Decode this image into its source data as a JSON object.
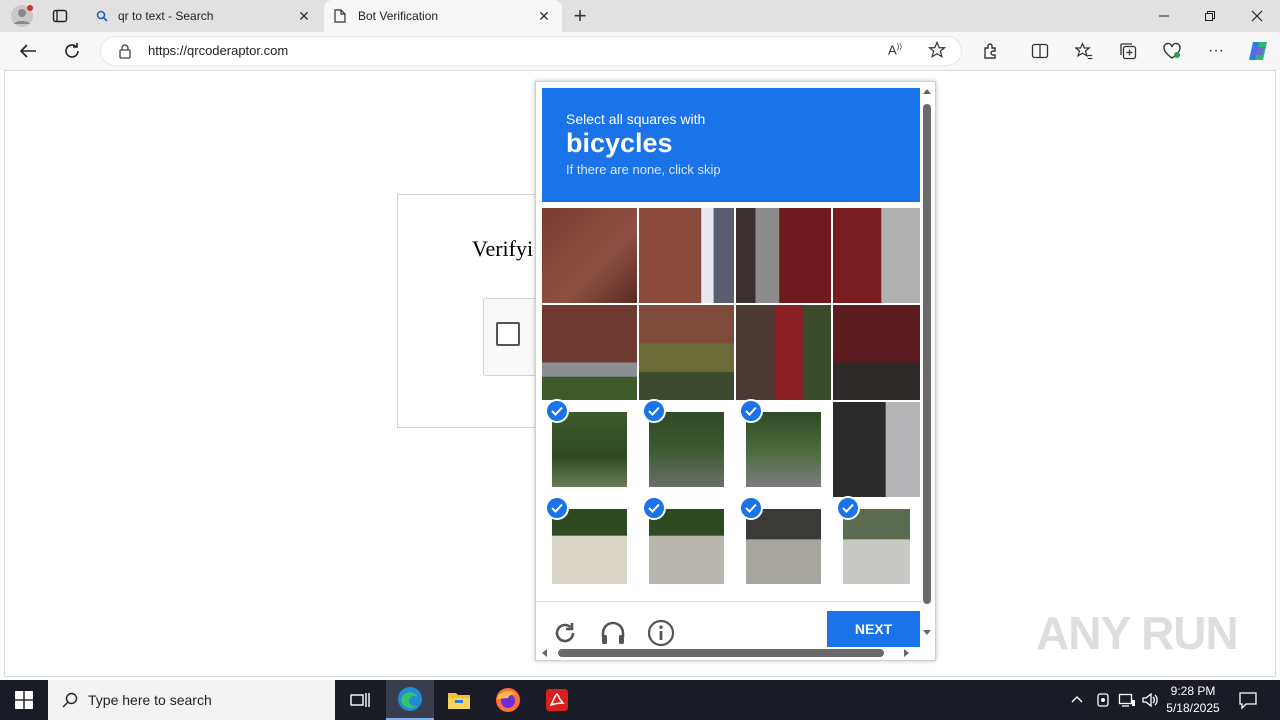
{
  "browser": {
    "tabs": [
      {
        "title": "qr to text - Search",
        "icon": "search-icon",
        "active": false
      },
      {
        "title": "Bot Verification",
        "icon": "page-icon",
        "active": true
      }
    ],
    "new_tab_label": "+",
    "url": "https://qrcoderaptor.com"
  },
  "page": {
    "verify_title": "Verifyi"
  },
  "captcha": {
    "select_text": "Select all squares with",
    "target": "bicycles",
    "skip_text": "If there are none, click skip",
    "next_label": "NEXT",
    "selected_tiles": [
      8,
      9,
      10,
      12,
      13,
      14,
      15
    ],
    "accent_color": "#1a73e8"
  },
  "taskbar": {
    "search_placeholder": "Type here to search",
    "time": "9:28 PM",
    "date": "5/18/2025"
  },
  "watermark": "ANY RUN"
}
